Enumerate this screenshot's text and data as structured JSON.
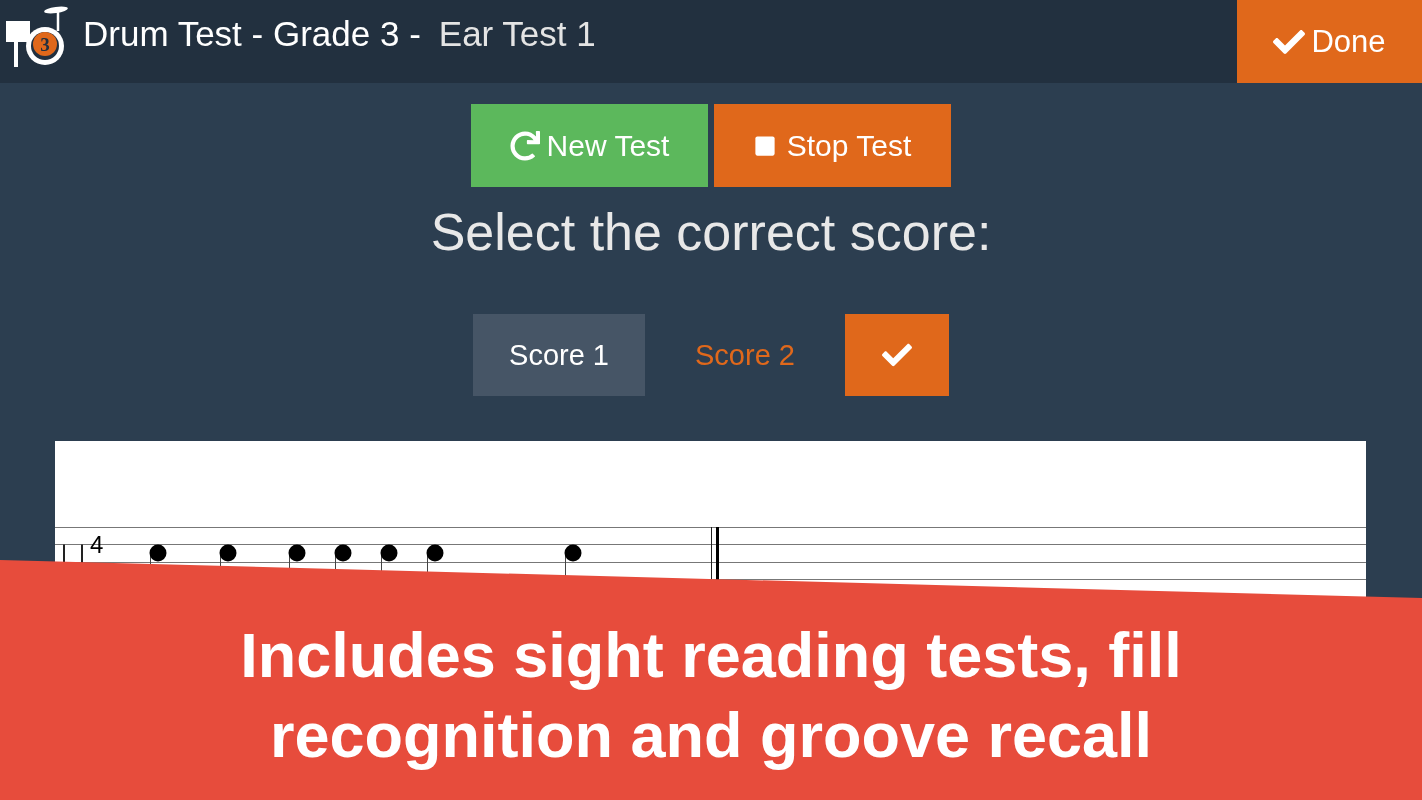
{
  "header": {
    "logo_badge": "3",
    "title": "Drum Test - Grade 3 -",
    "subtitle": "Ear Test 1",
    "done_button": "Done"
  },
  "actions": [
    {
      "kind": "start",
      "label": "New Test"
    },
    {
      "kind": "stop",
      "label": "Stop Test"
    }
  ],
  "prompt": "Select the correct score:",
  "score_choices": [
    {
      "label": "Score 1",
      "selected": true
    },
    {
      "label": "Score 2",
      "selected": false
    }
  ],
  "score_sheet": {
    "time_signature": "4"
  },
  "banner": {
    "text": "Includes sight reading tests, fill recognition and groove recall"
  }
}
